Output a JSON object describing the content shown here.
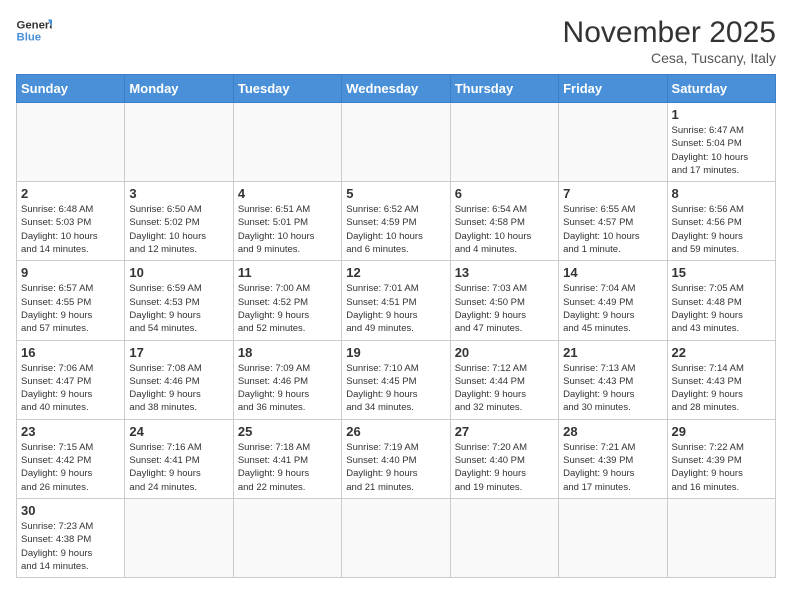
{
  "header": {
    "logo_general": "General",
    "logo_blue": "Blue",
    "month_title": "November 2025",
    "subtitle": "Cesa, Tuscany, Italy"
  },
  "weekdays": [
    "Sunday",
    "Monday",
    "Tuesday",
    "Wednesday",
    "Thursday",
    "Friday",
    "Saturday"
  ],
  "weeks": [
    [
      {
        "day": "",
        "info": ""
      },
      {
        "day": "",
        "info": ""
      },
      {
        "day": "",
        "info": ""
      },
      {
        "day": "",
        "info": ""
      },
      {
        "day": "",
        "info": ""
      },
      {
        "day": "",
        "info": ""
      },
      {
        "day": "1",
        "info": "Sunrise: 6:47 AM\nSunset: 5:04 PM\nDaylight: 10 hours\nand 17 minutes."
      }
    ],
    [
      {
        "day": "2",
        "info": "Sunrise: 6:48 AM\nSunset: 5:03 PM\nDaylight: 10 hours\nand 14 minutes."
      },
      {
        "day": "3",
        "info": "Sunrise: 6:50 AM\nSunset: 5:02 PM\nDaylight: 10 hours\nand 12 minutes."
      },
      {
        "day": "4",
        "info": "Sunrise: 6:51 AM\nSunset: 5:01 PM\nDaylight: 10 hours\nand 9 minutes."
      },
      {
        "day": "5",
        "info": "Sunrise: 6:52 AM\nSunset: 4:59 PM\nDaylight: 10 hours\nand 6 minutes."
      },
      {
        "day": "6",
        "info": "Sunrise: 6:54 AM\nSunset: 4:58 PM\nDaylight: 10 hours\nand 4 minutes."
      },
      {
        "day": "7",
        "info": "Sunrise: 6:55 AM\nSunset: 4:57 PM\nDaylight: 10 hours\nand 1 minute."
      },
      {
        "day": "8",
        "info": "Sunrise: 6:56 AM\nSunset: 4:56 PM\nDaylight: 9 hours\nand 59 minutes."
      }
    ],
    [
      {
        "day": "9",
        "info": "Sunrise: 6:57 AM\nSunset: 4:55 PM\nDaylight: 9 hours\nand 57 minutes."
      },
      {
        "day": "10",
        "info": "Sunrise: 6:59 AM\nSunset: 4:53 PM\nDaylight: 9 hours\nand 54 minutes."
      },
      {
        "day": "11",
        "info": "Sunrise: 7:00 AM\nSunset: 4:52 PM\nDaylight: 9 hours\nand 52 minutes."
      },
      {
        "day": "12",
        "info": "Sunrise: 7:01 AM\nSunset: 4:51 PM\nDaylight: 9 hours\nand 49 minutes."
      },
      {
        "day": "13",
        "info": "Sunrise: 7:03 AM\nSunset: 4:50 PM\nDaylight: 9 hours\nand 47 minutes."
      },
      {
        "day": "14",
        "info": "Sunrise: 7:04 AM\nSunset: 4:49 PM\nDaylight: 9 hours\nand 45 minutes."
      },
      {
        "day": "15",
        "info": "Sunrise: 7:05 AM\nSunset: 4:48 PM\nDaylight: 9 hours\nand 43 minutes."
      }
    ],
    [
      {
        "day": "16",
        "info": "Sunrise: 7:06 AM\nSunset: 4:47 PM\nDaylight: 9 hours\nand 40 minutes."
      },
      {
        "day": "17",
        "info": "Sunrise: 7:08 AM\nSunset: 4:46 PM\nDaylight: 9 hours\nand 38 minutes."
      },
      {
        "day": "18",
        "info": "Sunrise: 7:09 AM\nSunset: 4:46 PM\nDaylight: 9 hours\nand 36 minutes."
      },
      {
        "day": "19",
        "info": "Sunrise: 7:10 AM\nSunset: 4:45 PM\nDaylight: 9 hours\nand 34 minutes."
      },
      {
        "day": "20",
        "info": "Sunrise: 7:12 AM\nSunset: 4:44 PM\nDaylight: 9 hours\nand 32 minutes."
      },
      {
        "day": "21",
        "info": "Sunrise: 7:13 AM\nSunset: 4:43 PM\nDaylight: 9 hours\nand 30 minutes."
      },
      {
        "day": "22",
        "info": "Sunrise: 7:14 AM\nSunset: 4:43 PM\nDaylight: 9 hours\nand 28 minutes."
      }
    ],
    [
      {
        "day": "23",
        "info": "Sunrise: 7:15 AM\nSunset: 4:42 PM\nDaylight: 9 hours\nand 26 minutes."
      },
      {
        "day": "24",
        "info": "Sunrise: 7:16 AM\nSunset: 4:41 PM\nDaylight: 9 hours\nand 24 minutes."
      },
      {
        "day": "25",
        "info": "Sunrise: 7:18 AM\nSunset: 4:41 PM\nDaylight: 9 hours\nand 22 minutes."
      },
      {
        "day": "26",
        "info": "Sunrise: 7:19 AM\nSunset: 4:40 PM\nDaylight: 9 hours\nand 21 minutes."
      },
      {
        "day": "27",
        "info": "Sunrise: 7:20 AM\nSunset: 4:40 PM\nDaylight: 9 hours\nand 19 minutes."
      },
      {
        "day": "28",
        "info": "Sunrise: 7:21 AM\nSunset: 4:39 PM\nDaylight: 9 hours\nand 17 minutes."
      },
      {
        "day": "29",
        "info": "Sunrise: 7:22 AM\nSunset: 4:39 PM\nDaylight: 9 hours\nand 16 minutes."
      }
    ],
    [
      {
        "day": "30",
        "info": "Sunrise: 7:23 AM\nSunset: 4:38 PM\nDaylight: 9 hours\nand 14 minutes."
      },
      {
        "day": "",
        "info": ""
      },
      {
        "day": "",
        "info": ""
      },
      {
        "day": "",
        "info": ""
      },
      {
        "day": "",
        "info": ""
      },
      {
        "day": "",
        "info": ""
      },
      {
        "day": "",
        "info": ""
      }
    ]
  ]
}
